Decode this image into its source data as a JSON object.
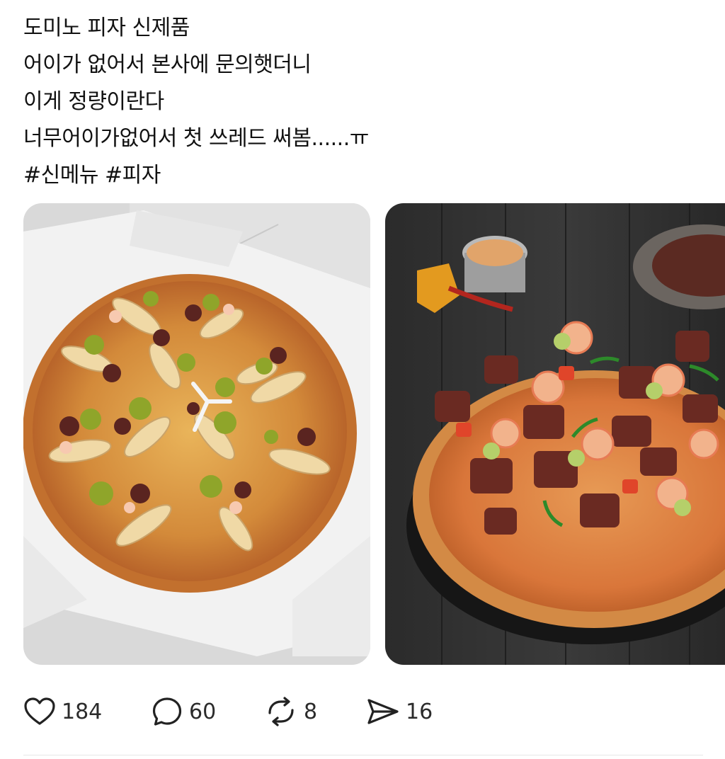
{
  "post": {
    "lines": [
      "도미노 피자 신제품",
      "어이가 없어서 본사에 문의햇더니",
      "이게 정량이란다",
      "너무어이가없어서 첫 쓰레드 써봄......ㅠ"
    ],
    "hashtags": [
      "#신메뉴",
      "#피자"
    ]
  },
  "actions": {
    "likes": "184",
    "comments": "60",
    "reposts": "8",
    "shares": "16"
  },
  "colors": {
    "text": "#111111",
    "icon": "#222222",
    "divider": "#e6e6e6"
  }
}
